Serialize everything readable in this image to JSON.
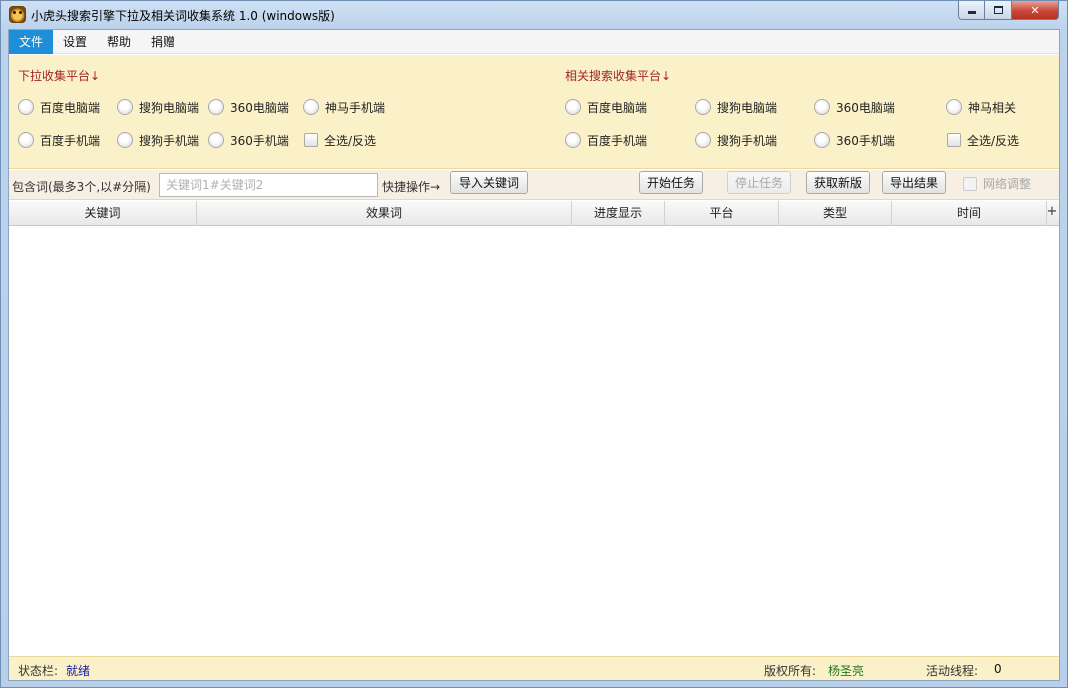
{
  "window": {
    "title": "小虎头搜索引擎下拉及相关词收集系统 1.0    (windows版)",
    "minimize_icon": "minimize-icon",
    "maximize_icon": "maximize-icon",
    "close_icon": "close-icon",
    "close_glyph": "✕"
  },
  "menu": {
    "items": [
      "文件",
      "设置",
      "帮助",
      "捐赠"
    ],
    "active": "文件"
  },
  "dropdown_section": {
    "title": "下拉收集平台↓",
    "row1": [
      "百度电脑端",
      "搜狗电脑端",
      "360电脑端",
      "神马手机端"
    ],
    "row2": [
      "百度手机端",
      "搜狗手机端",
      "360手机端"
    ],
    "select_all": "全选/反选"
  },
  "related_section": {
    "title": "相关搜索收集平台↓",
    "row1": [
      "百度电脑端",
      "搜狗电脑端",
      "360电脑端",
      "神马相关"
    ],
    "row2": [
      "百度手机端",
      "搜狗手机端",
      "360手机端"
    ],
    "select_all": "全选/反选"
  },
  "toolbar": {
    "include_label": "包含词(最多3个,以#分隔)",
    "include_placeholder": "关键词1#关键词2",
    "include_value": "",
    "quick_label": "快捷操作→",
    "import_button": "导入关键词",
    "start_button": "开始任务",
    "stop_button": "停止任务",
    "update_button": "获取新版",
    "export_button": "导出结果",
    "network_adjust": "网络调整"
  },
  "table": {
    "columns": [
      "关键词",
      "效果词",
      "进度显示",
      "平台",
      "类型",
      "时间"
    ],
    "add_column_glyph": "+",
    "rows": []
  },
  "status": {
    "status_label": "状态栏:",
    "status_value": "就绪",
    "copyright_label": "版权所有:",
    "copyright_value": "杨圣亮",
    "threads_label": "活动线程:",
    "threads_value": "0"
  },
  "colors": {
    "accent": "#1e8ed8",
    "panel_bg": "#fbf1c8",
    "section_title": "#a0262a",
    "toolbar_bg": "#f8efe4"
  }
}
